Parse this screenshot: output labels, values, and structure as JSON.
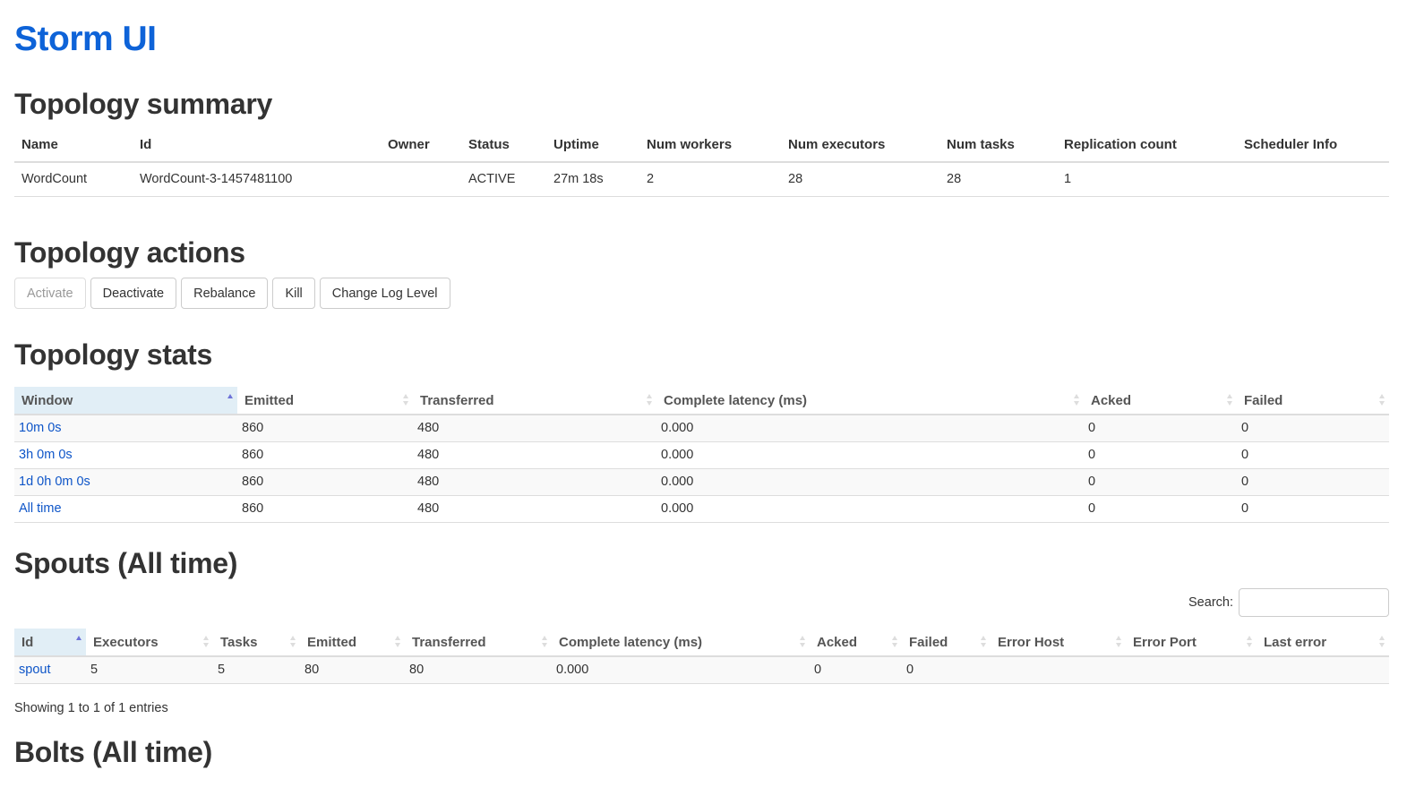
{
  "title": "Storm UI",
  "summary": {
    "heading": "Topology summary",
    "columns": [
      "Name",
      "Id",
      "Owner",
      "Status",
      "Uptime",
      "Num workers",
      "Num executors",
      "Num tasks",
      "Replication count",
      "Scheduler Info"
    ],
    "rows": [
      [
        "WordCount",
        "WordCount-3-1457481100",
        "",
        "ACTIVE",
        "27m 18s",
        "2",
        "28",
        "28",
        "1",
        ""
      ]
    ]
  },
  "actions": {
    "heading": "Topology actions",
    "buttons": [
      {
        "label": "Activate",
        "disabled": true
      },
      {
        "label": "Deactivate"
      },
      {
        "label": "Rebalance"
      },
      {
        "label": "Kill"
      },
      {
        "label": "Change Log Level"
      }
    ]
  },
  "stats": {
    "heading": "Topology stats",
    "columns": [
      "Window",
      "Emitted",
      "Transferred",
      "Complete latency (ms)",
      "Acked",
      "Failed"
    ],
    "sorted_column": 0,
    "rows": [
      [
        "10m 0s",
        "860",
        "480",
        "0.000",
        "0",
        "0"
      ],
      [
        "3h 0m 0s",
        "860",
        "480",
        "0.000",
        "0",
        "0"
      ],
      [
        "1d 0h 0m 0s",
        "860",
        "480",
        "0.000",
        "0",
        "0"
      ],
      [
        "All time",
        "860",
        "480",
        "0.000",
        "0",
        "0"
      ]
    ]
  },
  "spouts": {
    "heading": "Spouts (All time)",
    "search_label": "Search:",
    "search_value": "",
    "columns": [
      "Id",
      "Executors",
      "Tasks",
      "Emitted",
      "Transferred",
      "Complete latency (ms)",
      "Acked",
      "Failed",
      "Error Host",
      "Error Port",
      "Last error"
    ],
    "sorted_column": 0,
    "rows": [
      [
        "spout",
        "5",
        "5",
        "80",
        "80",
        "0.000",
        "0",
        "0",
        "",
        "",
        ""
      ]
    ],
    "info": "Showing 1 to 1 of 1 entries"
  },
  "bolts": {
    "heading": "Bolts (All time)"
  }
}
